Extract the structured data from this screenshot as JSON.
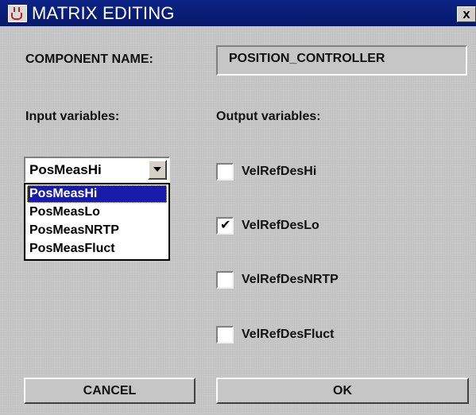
{
  "window": {
    "title": "MATRIX EDITING",
    "close_glyph": "x",
    "app_icon": "java-cup-icon"
  },
  "component": {
    "label": "COMPONENT NAME:",
    "value": "POSITION_CONTROLLER"
  },
  "inputs": {
    "label": "Input variables:",
    "selected": "PosMeasHi",
    "options": [
      "PosMeasHi",
      "PosMeasLo",
      "PosMeasNRTP",
      "PosMeasFluct"
    ]
  },
  "outputs": {
    "label": "Output variables:",
    "items": [
      {
        "label": "VelRefDesHi",
        "checked": false
      },
      {
        "label": "VelRefDesLo",
        "checked": true
      },
      {
        "label": "VelRefDesNRTP",
        "checked": false
      },
      {
        "label": "VelRefDesFluct",
        "checked": false
      }
    ]
  },
  "buttons": {
    "cancel": "CANCEL",
    "ok": "OK"
  }
}
